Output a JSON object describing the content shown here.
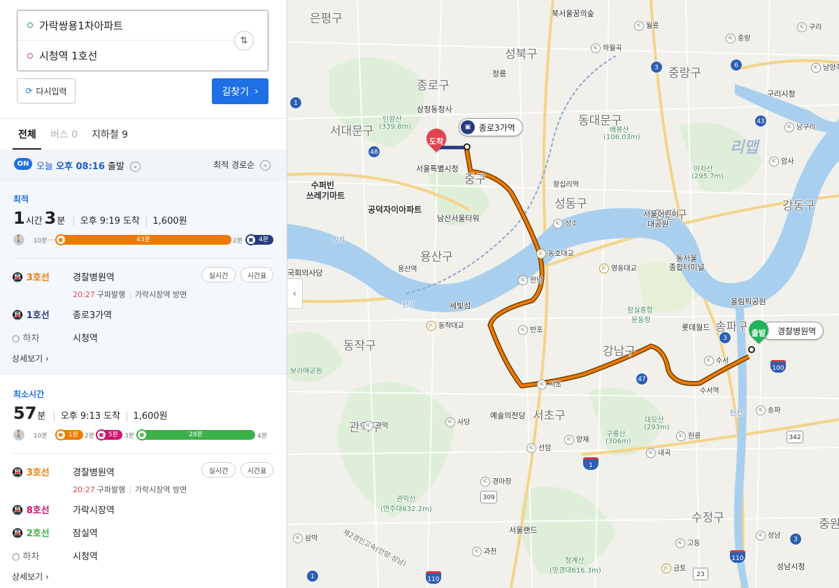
{
  "search": {
    "origin": "가락쌍용1차아파트",
    "destination": "시청역 1호선",
    "reset_label": "다시입력",
    "search_label": "길찾기"
  },
  "tabs": [
    {
      "label": "전체",
      "count": ""
    },
    {
      "label": "버스",
      "count": "0"
    },
    {
      "label": "지하철",
      "count": "9"
    }
  ],
  "depart": {
    "badge": "ON",
    "prefix": "오늘",
    "time": "오후 08:16",
    "suffix": "출발",
    "sort": "최적 경로순"
  },
  "routes": [
    {
      "label": "최적",
      "hours": "1",
      "hours_unit": "시간",
      "minutes": "3",
      "minutes_unit": "분",
      "arrival": "오후 9:19 도착",
      "fare": "1,600원",
      "bar": {
        "walk_start": "10분",
        "segments": [
          {
            "label": "43분",
            "color": "#f07a00",
            "fill": 0.68
          },
          {
            "label": "4분",
            "color": "#273a7e",
            "fill": 0.1
          }
        ],
        "gaps": [
          "2분"
        ]
      },
      "steps": [
        {
          "line": "3호선",
          "color": "#f07a00",
          "station": "경찰병원역",
          "pills": [
            "실시간",
            "시간표"
          ]
        },
        {
          "line": "1호선",
          "color": "#273a7e",
          "station": "종로3가역",
          "pills": []
        },
        {
          "line": "하차",
          "color": "#666666",
          "station": "시청역",
          "pills": []
        }
      ],
      "sub_info": {
        "time": "20:27",
        "text": "구파발행",
        "direction": "가락시장역 방면"
      },
      "detail": "상세보기"
    },
    {
      "label": "최소시간",
      "hours": "",
      "hours_unit": "",
      "minutes": "57",
      "minutes_unit": "분",
      "arrival": "오후 9:13 도착",
      "fare": "1,600원",
      "bar": {
        "walk_start": "10분",
        "segments": [
          {
            "label": "1분",
            "color": "#f07a00",
            "fill": 0.1
          },
          {
            "label": "5분",
            "color": "#d1136e",
            "fill": 0.1
          },
          {
            "label": "28분",
            "color": "#3cb24a",
            "fill": 0.45
          }
        ],
        "gaps": [
          "2분",
          "3분"
        ],
        "walk_end": "4분"
      },
      "steps": [
        {
          "line": "3호선",
          "color": "#f07a00",
          "station": "경찰병원역",
          "pills": [
            "실시간",
            "시간표"
          ]
        },
        {
          "line": "8호선",
          "color": "#d1136e",
          "station": "가락시장역",
          "pills": []
        },
        {
          "line": "2호선",
          "color": "#3cb24a",
          "station": "잠실역",
          "pills": []
        },
        {
          "line": "하차",
          "color": "#666666",
          "station": "시청역",
          "pills": []
        }
      ],
      "sub_info": {
        "time": "20:27",
        "text": "구파발행",
        "direction": "가락시장역 방면"
      },
      "detail": "상세보기"
    }
  ],
  "map": {
    "districts": [
      "은평구",
      "성북구",
      "종로구",
      "서대문구",
      "동대문구",
      "중구",
      "성동구",
      "용산구",
      "광진구",
      "강동구",
      "동작구",
      "강남구",
      "송파구",
      "서초구",
      "관악구",
      "수정구",
      "중원구",
      "중랑구"
    ],
    "pois": [
      "북서울꿈의숲",
      "정릉",
      "삼청동청사",
      "인왕산",
      "(339.8m)",
      "배봉산",
      "(106.03m)",
      "아차산",
      "(295.7m)",
      "서울특별시청",
      "남산서울타워",
      "수퍼빈",
      "쓰레기마트",
      "공덕자이아파트",
      "서울어린이",
      "대공원",
      "동서울",
      "종합터미널",
      "올림픽공원",
      "롯데월드",
      "잠실종합",
      "운동장",
      "보라매공원",
      "예술의전당",
      "대모산",
      "(293m)",
      "구룡산",
      "(306m)",
      "관악산",
      "(연주대632.2m)",
      "청계산",
      "(망경대616.3m)",
      "서울랜드",
      "국회의사당",
      "구리시청",
      "성남시청",
      "왕십리역",
      "용산역",
      "수서역",
      "탄천",
      "세빛섬",
      "한강",
      "밤섬"
    ],
    "ic_labels": [
      "월릉",
      "중랑",
      "구리",
      "하월곡",
      "남양주",
      "남구리",
      "암사",
      "성수",
      "동호대교",
      "영동대교",
      "한남",
      "반포",
      "서초",
      "수서",
      "송파",
      "헌릉",
      "내곡",
      "양재",
      "선암",
      "사당",
      "관악",
      "경마장",
      "과천",
      "삼막",
      "고등",
      "성남",
      "금토"
    ],
    "jc_labels": [
      "동작대교"
    ],
    "highways": [
      "3",
      "6",
      "1",
      "48",
      "43",
      "3",
      "47",
      "100",
      "342",
      "1",
      "309",
      "110",
      "110",
      "23",
      "3",
      "1"
    ],
    "road_label": "제2경인고속(안양-성남)",
    "route_tags": [
      "종로3가역",
      "경찰병원역"
    ],
    "pins": {
      "destination": "도착",
      "origin": "출발"
    },
    "watermark": "리맵"
  }
}
